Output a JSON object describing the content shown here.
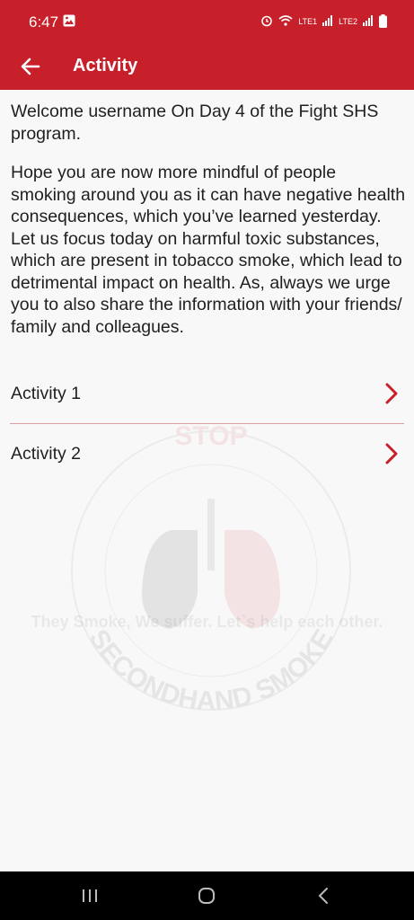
{
  "status_bar": {
    "time": "6:47",
    "sim1": "LTE1",
    "sim2": "LTE2"
  },
  "app_bar": {
    "title": "Activity",
    "back_icon": "arrow-left-icon",
    "background_color": "#c8202a"
  },
  "main": {
    "welcome": "Welcome username On Day 4 of the Fight SHS program.",
    "body": "Hope you are now more mindful of people smoking around you as it can have negative health consequences, which you’ve learned yesterday. Let us focus today on harmful toxic substances, which are present in tobacco smoke, which lead to detrimental impact on health. As, always we urge you to also share the information with your friends/ family and colleagues."
  },
  "activities": [
    {
      "label": "Activity 1",
      "icon": "chevron-right-icon"
    },
    {
      "label": "Activity 2",
      "icon": "chevron-right-icon"
    }
  ],
  "watermark": {
    "text_top": "STOP",
    "text_ring": "SECONDHAND SMOKE",
    "tagline": "They Smoke, We suffer. Let`s help each other."
  },
  "nav_bar": {
    "recents_icon": "recents-icon",
    "home_icon": "home-icon",
    "back_icon": "back-icon"
  }
}
